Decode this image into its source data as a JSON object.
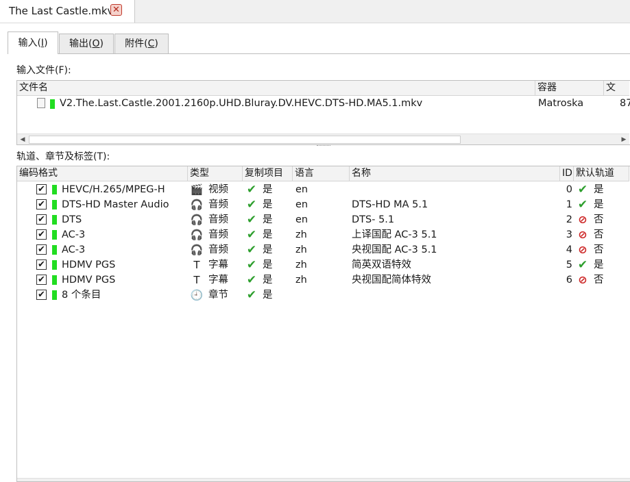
{
  "document_tab": {
    "title": "The Last Castle.mkv",
    "close_glyph": "✕"
  },
  "page_tabs": [
    {
      "label": "输入(I)",
      "mnemonic": "I",
      "prefix": "输入(",
      "suffix": ")",
      "active": true
    },
    {
      "label": "输出(O)",
      "mnemonic": "O",
      "prefix": "输出(",
      "suffix": ")",
      "active": false
    },
    {
      "label": "附件(C)",
      "mnemonic": "C",
      "prefix": "附件(",
      "suffix": ")",
      "active": false
    }
  ],
  "input_files": {
    "label": "输入文件(F):",
    "columns": [
      "文件名",
      "容器",
      "文"
    ],
    "rows": [
      {
        "name": "V2.The.Last.Castle.2001.2160p.UHD.Bluray.DV.HEVC.DTS-HD.MA5.1.mkv",
        "container": "Matroska",
        "size": "87"
      }
    ]
  },
  "tracks": {
    "label": "轨道、章节及标签(T):",
    "columns": [
      "编码格式",
      "类型",
      "复制项目",
      "语言",
      "名称",
      "ID",
      "默认轨道"
    ],
    "rows": [
      {
        "checked": true,
        "codec": "HEVC/H.265/MPEG-H",
        "type_icon": "clapperboard-icon",
        "type": "视频",
        "copy": "是",
        "lang": "en",
        "name": "",
        "id": "0",
        "default_icon": "check-icon",
        "default": "是"
      },
      {
        "checked": true,
        "codec": "DTS-HD Master Audio",
        "type_icon": "headphones-icon",
        "type": "音频",
        "copy": "是",
        "lang": "en",
        "name": "DTS-HD MA 5.1",
        "id": "1",
        "default_icon": "check-icon",
        "default": "是"
      },
      {
        "checked": true,
        "codec": "DTS",
        "type_icon": "headphones-icon",
        "type": "音频",
        "copy": "是",
        "lang": "en",
        "name": "DTS- 5.1",
        "id": "2",
        "default_icon": "no-icon",
        "default": "否"
      },
      {
        "checked": true,
        "codec": "AC-3",
        "type_icon": "headphones-icon",
        "type": "音频",
        "copy": "是",
        "lang": "zh",
        "name": "上译国配 AC-3 5.1",
        "id": "3",
        "default_icon": "no-icon",
        "default": "否"
      },
      {
        "checked": true,
        "codec": "AC-3",
        "type_icon": "headphones-icon",
        "type": "音频",
        "copy": "是",
        "lang": "zh",
        "name": "央视国配 AC-3 5.1",
        "id": "4",
        "default_icon": "no-icon",
        "default": "否"
      },
      {
        "checked": true,
        "codec": "HDMV PGS",
        "type_icon": "text-icon",
        "type": "字幕",
        "copy": "是",
        "lang": "zh",
        "name": "简英双语特效",
        "id": "5",
        "default_icon": "check-icon",
        "default": "是"
      },
      {
        "checked": true,
        "codec": "HDMV PGS",
        "type_icon": "text-icon",
        "type": "字幕",
        "copy": "是",
        "lang": "zh",
        "name": "央视国配简体特效",
        "id": "6",
        "default_icon": "no-icon",
        "default": "否"
      },
      {
        "checked": true,
        "codec": "8 个条目",
        "type_icon": "clock-icon",
        "type": "章节",
        "copy": "是",
        "lang": "",
        "name": "",
        "id": "",
        "default_icon": "",
        "default": ""
      }
    ]
  },
  "glyphs": {
    "check": "✔",
    "ok": "✔",
    "no": "⊘",
    "clapperboard": "🎬",
    "headphones": "🎧",
    "text": "T",
    "clock": "🕘",
    "left_arrow": "◀",
    "right_arrow": "▶"
  },
  "colors": {
    "green_marker": "#22dd22",
    "ok": "#2e9f2e",
    "no": "#cc2222"
  }
}
